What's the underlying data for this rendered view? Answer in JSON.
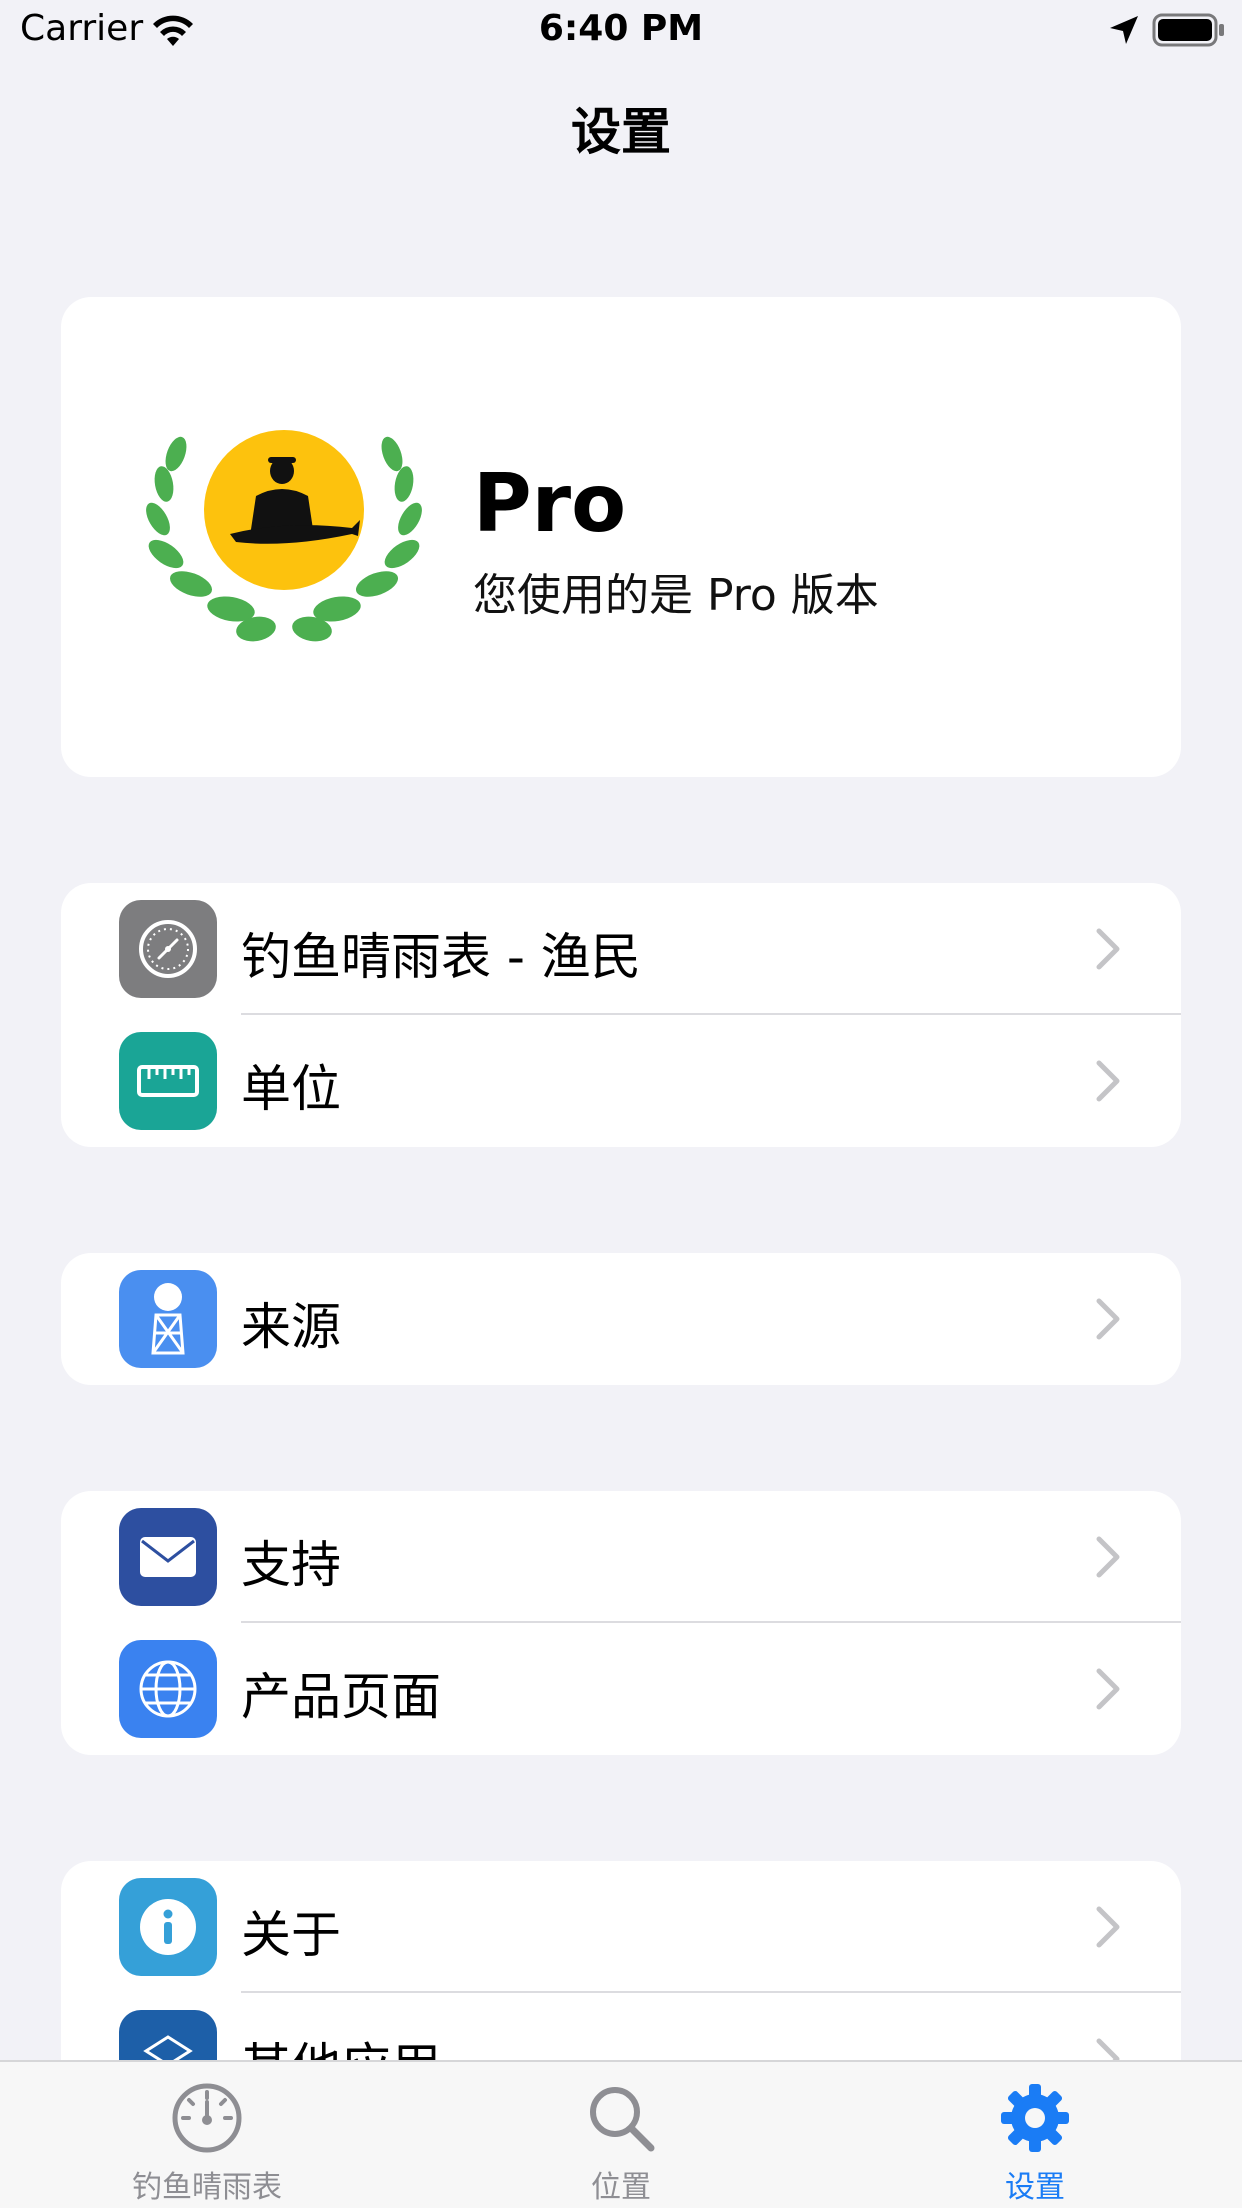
{
  "status_bar": {
    "carrier": "Carrier",
    "time": "6:40 PM"
  },
  "nav": {
    "title": "设置"
  },
  "pro_card": {
    "title": "Pro",
    "subtitle": "您使用的是 Pro 版本",
    "icon": "fisherman-laurel-logo"
  },
  "groups": [
    {
      "items": [
        {
          "label": "钓鱼晴雨表 - 渔民",
          "icon": "barometer-icon",
          "color": "#7d7d7f"
        },
        {
          "label": "单位",
          "icon": "ruler-icon",
          "color": "#1aa596"
        }
      ]
    },
    {
      "items": [
        {
          "label": "来源",
          "icon": "weather-station-icon",
          "color": "#4a8ff0"
        }
      ]
    },
    {
      "items": [
        {
          "label": "支持",
          "icon": "mail-icon",
          "color": "#2d4fa0"
        },
        {
          "label": "产品页面",
          "icon": "globe-icon",
          "color": "#3a82f0"
        }
      ]
    },
    {
      "items": [
        {
          "label": "关于",
          "icon": "info-icon",
          "color": "#35a0d8"
        },
        {
          "label": "其他应用",
          "icon": "apps-icon",
          "color": "#1d5fa8"
        }
      ]
    }
  ],
  "tab_bar": {
    "tabs": [
      {
        "label": "钓鱼晴雨表",
        "icon": "gauge-icon",
        "active": false
      },
      {
        "label": "位置",
        "icon": "search-icon",
        "active": false
      },
      {
        "label": "设置",
        "icon": "gear-icon",
        "active": true
      }
    ],
    "active_color": "#1a7cf5",
    "inactive_color": "#8e8e93"
  }
}
